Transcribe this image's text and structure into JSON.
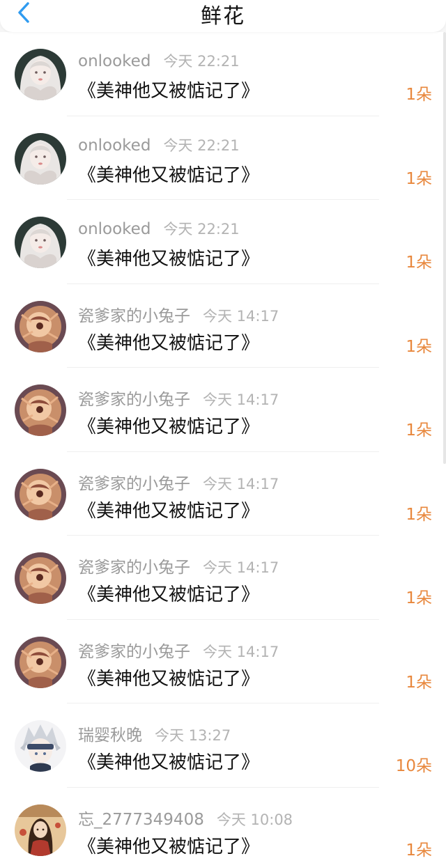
{
  "header": {
    "title": "鲜花",
    "back_icon": "chevron-left-icon",
    "accent_color": "#2f9bf0"
  },
  "records": [
    {
      "username": "onlooked",
      "time": "今天 22:21",
      "book": "《美神他又被惦记了》",
      "count": "1朵",
      "avatar": "avatar-a"
    },
    {
      "username": "onlooked",
      "time": "今天 22:21",
      "book": "《美神他又被惦记了》",
      "count": "1朵",
      "avatar": "avatar-a"
    },
    {
      "username": "onlooked",
      "time": "今天 22:21",
      "book": "《美神他又被惦记了》",
      "count": "1朵",
      "avatar": "avatar-a"
    },
    {
      "username": "瓷爹家的小兔子",
      "time": "今天 14:17",
      "book": "《美神他又被惦记了》",
      "count": "1朵",
      "avatar": "avatar-b"
    },
    {
      "username": "瓷爹家的小兔子",
      "time": "今天 14:17",
      "book": "《美神他又被惦记了》",
      "count": "1朵",
      "avatar": "avatar-b"
    },
    {
      "username": "瓷爹家的小兔子",
      "time": "今天 14:17",
      "book": "《美神他又被惦记了》",
      "count": "1朵",
      "avatar": "avatar-b"
    },
    {
      "username": "瓷爹家的小兔子",
      "time": "今天 14:17",
      "book": "《美神他又被惦记了》",
      "count": "1朵",
      "avatar": "avatar-b"
    },
    {
      "username": "瓷爹家的小兔子",
      "time": "今天 14:17",
      "book": "《美神他又被惦记了》",
      "count": "1朵",
      "avatar": "avatar-b"
    },
    {
      "username": "瑞婴秋晚",
      "time": "今天 13:27",
      "book": "《美神他又被惦记了》",
      "count": "10朵",
      "avatar": "avatar-c"
    },
    {
      "username": "忘_2777349408",
      "time": "今天 10:08",
      "book": "《美神他又被惦记了》",
      "count": "1朵",
      "avatar": "avatar-d"
    }
  ],
  "colors": {
    "count": "#e8873c",
    "username": "#9a9a9a",
    "time": "#b3b3b3",
    "title": "#111111"
  }
}
